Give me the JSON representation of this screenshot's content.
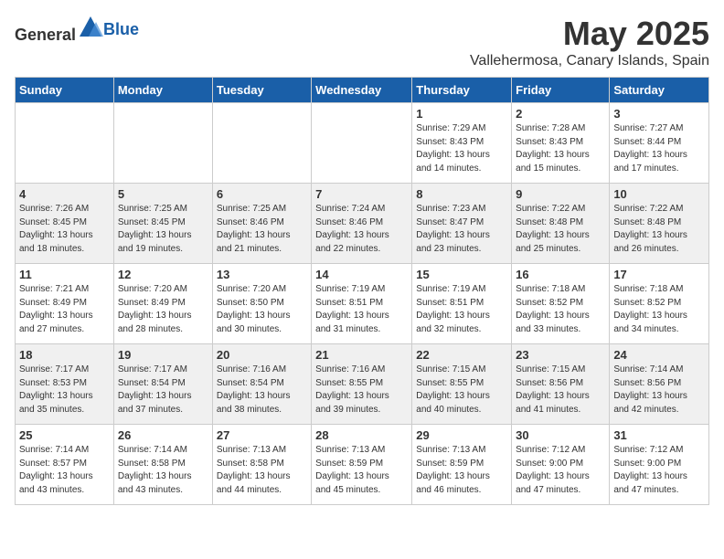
{
  "header": {
    "logo_general": "General",
    "logo_blue": "Blue",
    "month": "May 2025",
    "location": "Vallehermosa, Canary Islands, Spain"
  },
  "weekdays": [
    "Sunday",
    "Monday",
    "Tuesday",
    "Wednesday",
    "Thursday",
    "Friday",
    "Saturday"
  ],
  "weeks": [
    [
      {
        "day": "",
        "info": ""
      },
      {
        "day": "",
        "info": ""
      },
      {
        "day": "",
        "info": ""
      },
      {
        "day": "",
        "info": ""
      },
      {
        "day": "1",
        "info": "Sunrise: 7:29 AM\nSunset: 8:43 PM\nDaylight: 13 hours\nand 14 minutes."
      },
      {
        "day": "2",
        "info": "Sunrise: 7:28 AM\nSunset: 8:43 PM\nDaylight: 13 hours\nand 15 minutes."
      },
      {
        "day": "3",
        "info": "Sunrise: 7:27 AM\nSunset: 8:44 PM\nDaylight: 13 hours\nand 17 minutes."
      }
    ],
    [
      {
        "day": "4",
        "info": "Sunrise: 7:26 AM\nSunset: 8:45 PM\nDaylight: 13 hours\nand 18 minutes."
      },
      {
        "day": "5",
        "info": "Sunrise: 7:25 AM\nSunset: 8:45 PM\nDaylight: 13 hours\nand 19 minutes."
      },
      {
        "day": "6",
        "info": "Sunrise: 7:25 AM\nSunset: 8:46 PM\nDaylight: 13 hours\nand 21 minutes."
      },
      {
        "day": "7",
        "info": "Sunrise: 7:24 AM\nSunset: 8:46 PM\nDaylight: 13 hours\nand 22 minutes."
      },
      {
        "day": "8",
        "info": "Sunrise: 7:23 AM\nSunset: 8:47 PM\nDaylight: 13 hours\nand 23 minutes."
      },
      {
        "day": "9",
        "info": "Sunrise: 7:22 AM\nSunset: 8:48 PM\nDaylight: 13 hours\nand 25 minutes."
      },
      {
        "day": "10",
        "info": "Sunrise: 7:22 AM\nSunset: 8:48 PM\nDaylight: 13 hours\nand 26 minutes."
      }
    ],
    [
      {
        "day": "11",
        "info": "Sunrise: 7:21 AM\nSunset: 8:49 PM\nDaylight: 13 hours\nand 27 minutes."
      },
      {
        "day": "12",
        "info": "Sunrise: 7:20 AM\nSunset: 8:49 PM\nDaylight: 13 hours\nand 28 minutes."
      },
      {
        "day": "13",
        "info": "Sunrise: 7:20 AM\nSunset: 8:50 PM\nDaylight: 13 hours\nand 30 minutes."
      },
      {
        "day": "14",
        "info": "Sunrise: 7:19 AM\nSunset: 8:51 PM\nDaylight: 13 hours\nand 31 minutes."
      },
      {
        "day": "15",
        "info": "Sunrise: 7:19 AM\nSunset: 8:51 PM\nDaylight: 13 hours\nand 32 minutes."
      },
      {
        "day": "16",
        "info": "Sunrise: 7:18 AM\nSunset: 8:52 PM\nDaylight: 13 hours\nand 33 minutes."
      },
      {
        "day": "17",
        "info": "Sunrise: 7:18 AM\nSunset: 8:52 PM\nDaylight: 13 hours\nand 34 minutes."
      }
    ],
    [
      {
        "day": "18",
        "info": "Sunrise: 7:17 AM\nSunset: 8:53 PM\nDaylight: 13 hours\nand 35 minutes."
      },
      {
        "day": "19",
        "info": "Sunrise: 7:17 AM\nSunset: 8:54 PM\nDaylight: 13 hours\nand 37 minutes."
      },
      {
        "day": "20",
        "info": "Sunrise: 7:16 AM\nSunset: 8:54 PM\nDaylight: 13 hours\nand 38 minutes."
      },
      {
        "day": "21",
        "info": "Sunrise: 7:16 AM\nSunset: 8:55 PM\nDaylight: 13 hours\nand 39 minutes."
      },
      {
        "day": "22",
        "info": "Sunrise: 7:15 AM\nSunset: 8:55 PM\nDaylight: 13 hours\nand 40 minutes."
      },
      {
        "day": "23",
        "info": "Sunrise: 7:15 AM\nSunset: 8:56 PM\nDaylight: 13 hours\nand 41 minutes."
      },
      {
        "day": "24",
        "info": "Sunrise: 7:14 AM\nSunset: 8:56 PM\nDaylight: 13 hours\nand 42 minutes."
      }
    ],
    [
      {
        "day": "25",
        "info": "Sunrise: 7:14 AM\nSunset: 8:57 PM\nDaylight: 13 hours\nand 43 minutes."
      },
      {
        "day": "26",
        "info": "Sunrise: 7:14 AM\nSunset: 8:58 PM\nDaylight: 13 hours\nand 43 minutes."
      },
      {
        "day": "27",
        "info": "Sunrise: 7:13 AM\nSunset: 8:58 PM\nDaylight: 13 hours\nand 44 minutes."
      },
      {
        "day": "28",
        "info": "Sunrise: 7:13 AM\nSunset: 8:59 PM\nDaylight: 13 hours\nand 45 minutes."
      },
      {
        "day": "29",
        "info": "Sunrise: 7:13 AM\nSunset: 8:59 PM\nDaylight: 13 hours\nand 46 minutes."
      },
      {
        "day": "30",
        "info": "Sunrise: 7:12 AM\nSunset: 9:00 PM\nDaylight: 13 hours\nand 47 minutes."
      },
      {
        "day": "31",
        "info": "Sunrise: 7:12 AM\nSunset: 9:00 PM\nDaylight: 13 hours\nand 47 minutes."
      }
    ]
  ]
}
